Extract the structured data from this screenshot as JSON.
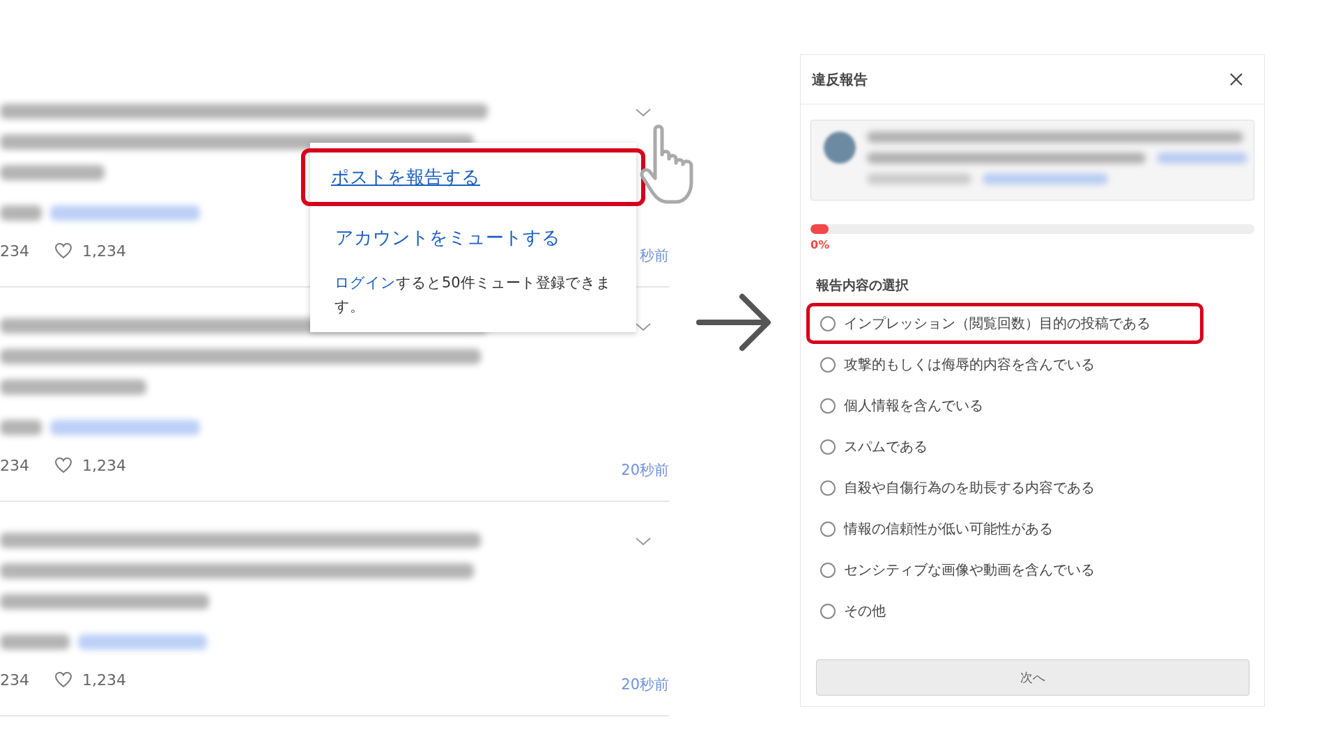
{
  "posts": [
    {
      "retweets": "234",
      "likes": "1,234",
      "time": "秒前"
    },
    {
      "retweets": "234",
      "likes": "1,234",
      "time": "20秒前"
    },
    {
      "retweets": "234",
      "likes": "1,234",
      "time": "20秒前"
    }
  ],
  "post_menu": {
    "items": [
      {
        "label": "ポストを報告する",
        "highlighted": true,
        "underlined": true
      },
      {
        "label": "アカウントをミュートする",
        "highlighted": false,
        "underlined": false
      }
    ],
    "note": {
      "link": "ログイン",
      "text": "すると50件ミュート登録できます。"
    }
  },
  "report_dialog": {
    "title": "違反報告",
    "progress": {
      "level": 0,
      "reading": "0%"
    },
    "section_title": "報告内容の選択",
    "options": [
      {
        "label": "インプレッション（閲覧回数）目的の投稿である",
        "selected": false,
        "highlighted": true
      },
      {
        "label": "攻撃的もしくは侮辱的内容を含んでいる",
        "selected": false,
        "highlighted": false
      },
      {
        "label": "個人情報を含んでいる",
        "selected": false,
        "highlighted": false
      },
      {
        "label": "スパムである",
        "selected": false,
        "highlighted": false
      },
      {
        "label": "自殺や自傷行為のを助長する内容である",
        "selected": false,
        "highlighted": false
      },
      {
        "label": "情報の信頼性が低い可能性がある",
        "selected": false,
        "highlighted": false
      },
      {
        "label": "センシティブな画像や動画を含んでいる",
        "selected": false,
        "highlighted": false
      },
      {
        "label": "その他",
        "selected": false,
        "highlighted": false
      }
    ],
    "next_button": {
      "label": "次へ",
      "disabled": true
    }
  }
}
